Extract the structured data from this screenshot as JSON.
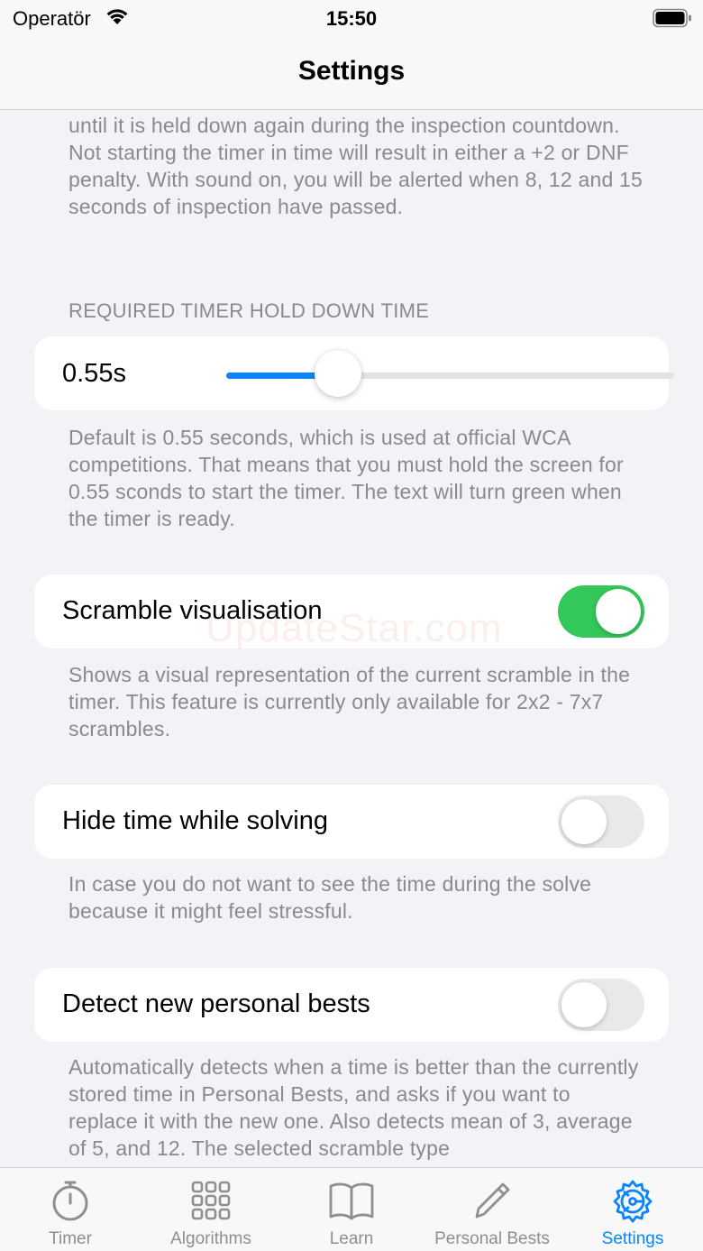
{
  "status_bar": {
    "carrier": "Operatör",
    "time": "15:50"
  },
  "nav": {
    "title": "Settings"
  },
  "inspection_footer": "until it is held down again during the inspection countdown. Not starting the timer in time will result in either a +2 or DNF penalty. With sound on, you will be alerted when 8, 12 and 15 seconds of inspection have passed.",
  "hold_down": {
    "header": "REQUIRED TIMER HOLD DOWN TIME",
    "value_label": "0.55s",
    "slider_fraction": 0.25,
    "footer": "Default is 0.55 seconds, which is used at official WCA competitions. That means that you must hold the screen for 0.55 sconds to start the timer. The text will turn green when the timer is ready."
  },
  "scramble_visualisation": {
    "label": "Scramble visualisation",
    "enabled": true,
    "footer": "Shows a visual representation of the current scramble in the timer. This feature is currently only available for 2x2 - 7x7 scrambles."
  },
  "hide_time": {
    "label": "Hide time while solving",
    "enabled": false,
    "footer": "In case you do not want to see the time during the solve because it might feel stressful."
  },
  "detect_pb": {
    "label": "Detect new personal bests",
    "enabled": false,
    "footer": "Automatically detects when a time is better than the currently stored time in Personal Bests, and asks if you want to replace it with the new one. Also detects mean of 3, average of 5, and 12. The selected scramble type"
  },
  "watermark": "UpdateStar.com",
  "tabs": [
    {
      "label": "Timer",
      "icon": "stopwatch-icon"
    },
    {
      "label": "Algorithms",
      "icon": "grid-icon"
    },
    {
      "label": "Learn",
      "icon": "book-icon"
    },
    {
      "label": "Personal Bests",
      "icon": "pencil-icon"
    },
    {
      "label": "Settings",
      "icon": "gear-icon"
    }
  ],
  "colors": {
    "accent": "#0a84ff",
    "toggle_on": "#34c759",
    "background": "#f2f2f7",
    "secondary_text": "#8a8a8e"
  }
}
